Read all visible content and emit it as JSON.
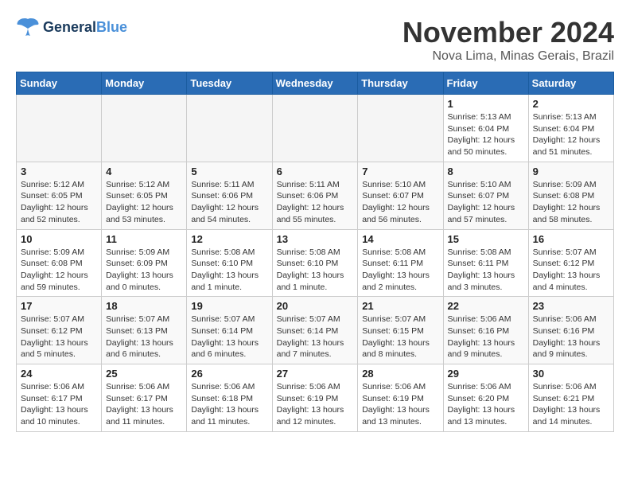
{
  "header": {
    "logo_line1": "General",
    "logo_line2": "Blue",
    "month": "November 2024",
    "location": "Nova Lima, Minas Gerais, Brazil"
  },
  "weekdays": [
    "Sunday",
    "Monday",
    "Tuesday",
    "Wednesday",
    "Thursday",
    "Friday",
    "Saturday"
  ],
  "weeks": [
    [
      {
        "day": "",
        "info": ""
      },
      {
        "day": "",
        "info": ""
      },
      {
        "day": "",
        "info": ""
      },
      {
        "day": "",
        "info": ""
      },
      {
        "day": "",
        "info": ""
      },
      {
        "day": "1",
        "info": "Sunrise: 5:13 AM\nSunset: 6:04 PM\nDaylight: 12 hours\nand 50 minutes."
      },
      {
        "day": "2",
        "info": "Sunrise: 5:13 AM\nSunset: 6:04 PM\nDaylight: 12 hours\nand 51 minutes."
      }
    ],
    [
      {
        "day": "3",
        "info": "Sunrise: 5:12 AM\nSunset: 6:05 PM\nDaylight: 12 hours\nand 52 minutes."
      },
      {
        "day": "4",
        "info": "Sunrise: 5:12 AM\nSunset: 6:05 PM\nDaylight: 12 hours\nand 53 minutes."
      },
      {
        "day": "5",
        "info": "Sunrise: 5:11 AM\nSunset: 6:06 PM\nDaylight: 12 hours\nand 54 minutes."
      },
      {
        "day": "6",
        "info": "Sunrise: 5:11 AM\nSunset: 6:06 PM\nDaylight: 12 hours\nand 55 minutes."
      },
      {
        "day": "7",
        "info": "Sunrise: 5:10 AM\nSunset: 6:07 PM\nDaylight: 12 hours\nand 56 minutes."
      },
      {
        "day": "8",
        "info": "Sunrise: 5:10 AM\nSunset: 6:07 PM\nDaylight: 12 hours\nand 57 minutes."
      },
      {
        "day": "9",
        "info": "Sunrise: 5:09 AM\nSunset: 6:08 PM\nDaylight: 12 hours\nand 58 minutes."
      }
    ],
    [
      {
        "day": "10",
        "info": "Sunrise: 5:09 AM\nSunset: 6:08 PM\nDaylight: 12 hours\nand 59 minutes."
      },
      {
        "day": "11",
        "info": "Sunrise: 5:09 AM\nSunset: 6:09 PM\nDaylight: 13 hours\nand 0 minutes."
      },
      {
        "day": "12",
        "info": "Sunrise: 5:08 AM\nSunset: 6:10 PM\nDaylight: 13 hours\nand 1 minute."
      },
      {
        "day": "13",
        "info": "Sunrise: 5:08 AM\nSunset: 6:10 PM\nDaylight: 13 hours\nand 1 minute."
      },
      {
        "day": "14",
        "info": "Sunrise: 5:08 AM\nSunset: 6:11 PM\nDaylight: 13 hours\nand 2 minutes."
      },
      {
        "day": "15",
        "info": "Sunrise: 5:08 AM\nSunset: 6:11 PM\nDaylight: 13 hours\nand 3 minutes."
      },
      {
        "day": "16",
        "info": "Sunrise: 5:07 AM\nSunset: 6:12 PM\nDaylight: 13 hours\nand 4 minutes."
      }
    ],
    [
      {
        "day": "17",
        "info": "Sunrise: 5:07 AM\nSunset: 6:12 PM\nDaylight: 13 hours\nand 5 minutes."
      },
      {
        "day": "18",
        "info": "Sunrise: 5:07 AM\nSunset: 6:13 PM\nDaylight: 13 hours\nand 6 minutes."
      },
      {
        "day": "19",
        "info": "Sunrise: 5:07 AM\nSunset: 6:14 PM\nDaylight: 13 hours\nand 6 minutes."
      },
      {
        "day": "20",
        "info": "Sunrise: 5:07 AM\nSunset: 6:14 PM\nDaylight: 13 hours\nand 7 minutes."
      },
      {
        "day": "21",
        "info": "Sunrise: 5:07 AM\nSunset: 6:15 PM\nDaylight: 13 hours\nand 8 minutes."
      },
      {
        "day": "22",
        "info": "Sunrise: 5:06 AM\nSunset: 6:16 PM\nDaylight: 13 hours\nand 9 minutes."
      },
      {
        "day": "23",
        "info": "Sunrise: 5:06 AM\nSunset: 6:16 PM\nDaylight: 13 hours\nand 9 minutes."
      }
    ],
    [
      {
        "day": "24",
        "info": "Sunrise: 5:06 AM\nSunset: 6:17 PM\nDaylight: 13 hours\nand 10 minutes."
      },
      {
        "day": "25",
        "info": "Sunrise: 5:06 AM\nSunset: 6:17 PM\nDaylight: 13 hours\nand 11 minutes."
      },
      {
        "day": "26",
        "info": "Sunrise: 5:06 AM\nSunset: 6:18 PM\nDaylight: 13 hours\nand 11 minutes."
      },
      {
        "day": "27",
        "info": "Sunrise: 5:06 AM\nSunset: 6:19 PM\nDaylight: 13 hours\nand 12 minutes."
      },
      {
        "day": "28",
        "info": "Sunrise: 5:06 AM\nSunset: 6:19 PM\nDaylight: 13 hours\nand 13 minutes."
      },
      {
        "day": "29",
        "info": "Sunrise: 5:06 AM\nSunset: 6:20 PM\nDaylight: 13 hours\nand 13 minutes."
      },
      {
        "day": "30",
        "info": "Sunrise: 5:06 AM\nSunset: 6:21 PM\nDaylight: 13 hours\nand 14 minutes."
      }
    ]
  ]
}
